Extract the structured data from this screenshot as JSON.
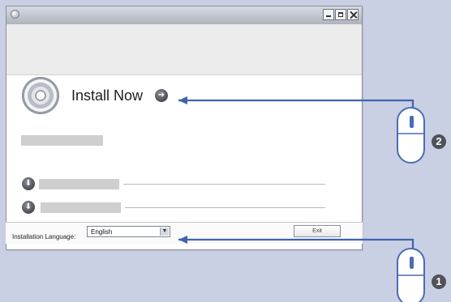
{
  "install": {
    "label": "Install Now"
  },
  "footer": {
    "language_label": "Installation Language:",
    "language_value": "English",
    "exit_label": "Exit"
  },
  "annotations": {
    "step_one": "1",
    "step_two": "2"
  },
  "colors": {
    "background": "#c9d0e3",
    "callout_line": "#3e63b0",
    "badge": "#4f5256"
  }
}
